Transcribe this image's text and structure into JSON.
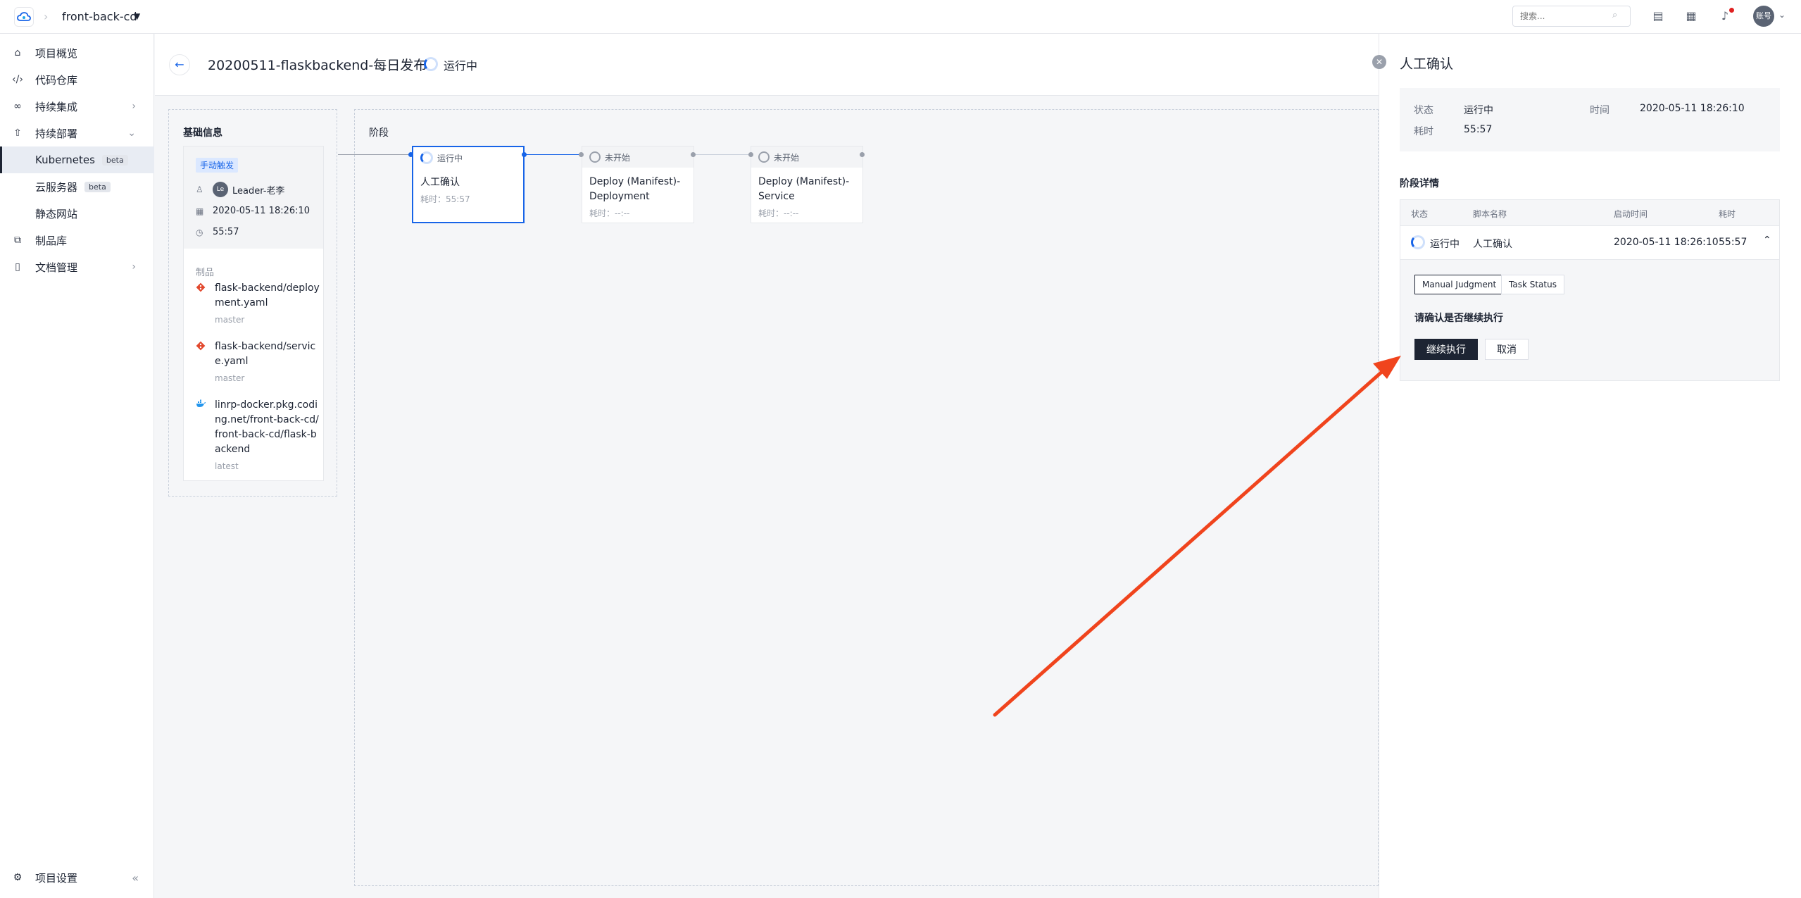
{
  "topbar": {
    "project_name": "front-back-cd",
    "search_placeholder": "搜索...",
    "avatar_text": "账号",
    "icons": [
      "chat-icon",
      "calendar-icon",
      "bell-icon"
    ]
  },
  "sidebar": {
    "items": [
      {
        "label": "项目概览",
        "icon": "home-icon"
      },
      {
        "label": "代码仓库",
        "icon": "code-icon"
      },
      {
        "label": "持续集成",
        "icon": "infinity-icon"
      },
      {
        "label": "持续部署",
        "icon": "rocket-icon"
      },
      {
        "label": "Kubernetes",
        "badge": "beta"
      },
      {
        "label": "云服务器",
        "badge": "beta"
      },
      {
        "label": "静态网站"
      },
      {
        "label": "制品库",
        "icon": "package-icon"
      },
      {
        "label": "文档管理",
        "icon": "doc-icon"
      }
    ],
    "settings_label": "项目设置"
  },
  "header": {
    "title": "20200511-flaskbackend-每日发布",
    "status": "运行中"
  },
  "basic": {
    "title": "基础信息",
    "trigger_tag": "手动触发",
    "user": "Leader-老李",
    "user_avatar": "Le",
    "date": "2020-05-11 18:26:10",
    "duration": "55:57",
    "artifacts_label": "制品",
    "artifacts": [
      {
        "name": "flask-backend/deployment.yaml",
        "ref": "master",
        "icon": "git-icon"
      },
      {
        "name": "flask-backend/service.yaml",
        "ref": "master",
        "icon": "git-icon"
      },
      {
        "name": "linrp-docker.pkg.coding.net/front-back-cd/front-back-cd/flask-backend",
        "ref": "latest",
        "icon": "docker-icon"
      }
    ]
  },
  "stages": {
    "title": "阶段",
    "items": [
      {
        "status": "运行中",
        "name": "人工确认",
        "time": "耗时：55:57"
      },
      {
        "status": "未开始",
        "name": "Deploy (Manifest)-Deployment",
        "time": "耗时：--:--"
      },
      {
        "status": "未开始",
        "name": "Deploy (Manifest)-Service",
        "time": "耗时：--:--"
      }
    ]
  },
  "panel": {
    "title": "人工确认",
    "status_label": "状态",
    "status_value": "运行中",
    "time_label": "时间",
    "time_value": "2020-05-11 18:26:10",
    "duration_label": "耗时",
    "duration_value": "55:57",
    "detail_title": "阶段详情",
    "columns": [
      "状态",
      "脚本名称",
      "启动时间",
      "耗时"
    ],
    "row": {
      "status": "运行中",
      "name": "人工确认",
      "start": "2020-05-11 18:26:10",
      "duration": "55:57"
    },
    "tabs": [
      "Manual Judgment",
      "Task Status"
    ],
    "question": "请确认是否继续执行",
    "confirm_label": "继续执行",
    "cancel_label": "取消"
  },
  "colors": {
    "accent": "#1764e8",
    "dark": "#1d2433",
    "annotation_arrow": "#f0441d"
  }
}
